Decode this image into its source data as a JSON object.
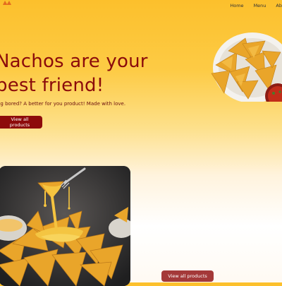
{
  "nav": {
    "items": [
      "Home",
      "Menu",
      "Ab"
    ]
  },
  "hero": {
    "title_line1": "Nachos are your",
    "title_line2": "best friend!",
    "subtitle": "ng bored? A better for you product! Made with love.",
    "cta_label": "View all products"
  },
  "secondary": {
    "cta_label": "View all products"
  },
  "colors": {
    "brand": "#8b0b0b",
    "button": "#8d0b0b",
    "button_secondary": "#a43939",
    "background_top": "#fcc02c"
  }
}
